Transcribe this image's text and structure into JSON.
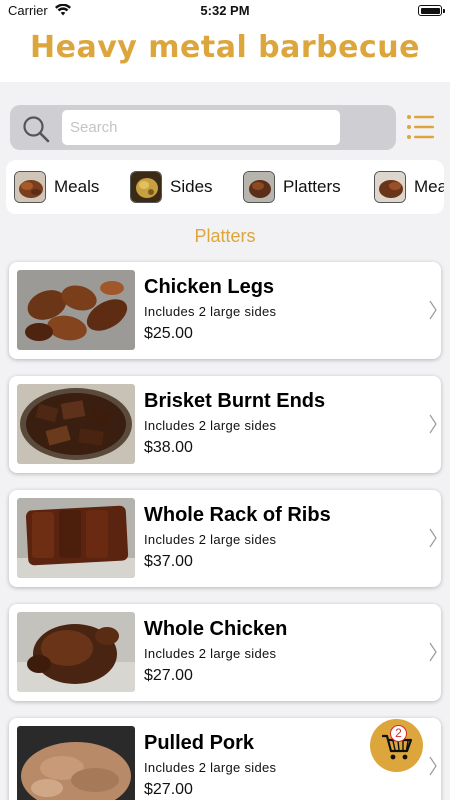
{
  "status_bar": {
    "carrier": "Carrier",
    "time": "5:32 PM"
  },
  "app": {
    "title": "Heavy metal barbecue",
    "accent_color": "#dca63c"
  },
  "search": {
    "placeholder": "Search",
    "value": "",
    "icon": "search-icon",
    "menu_icon": "list-icon"
  },
  "categories": [
    {
      "label": "Meals"
    },
    {
      "label": "Sides"
    },
    {
      "label": "Platters"
    },
    {
      "label": "Meals"
    }
  ],
  "section": {
    "title": "Platters"
  },
  "items": [
    {
      "name": "Chicken Legs",
      "description": "Includes 2 large sides",
      "price": "$25.00"
    },
    {
      "name": "Brisket Burnt Ends",
      "description": "Includes 2 large sides",
      "price": "$38.00"
    },
    {
      "name": "Whole Rack of Ribs",
      "description": "Includes 2 large sides",
      "price": "$37.00"
    },
    {
      "name": "Whole Chicken",
      "description": "Includes 2 large sides",
      "price": "$27.00"
    },
    {
      "name": "Pulled Pork",
      "description": "Includes 2 large sides",
      "price": "$27.00"
    }
  ],
  "cart": {
    "count": "2",
    "icon": "cart-icon"
  }
}
